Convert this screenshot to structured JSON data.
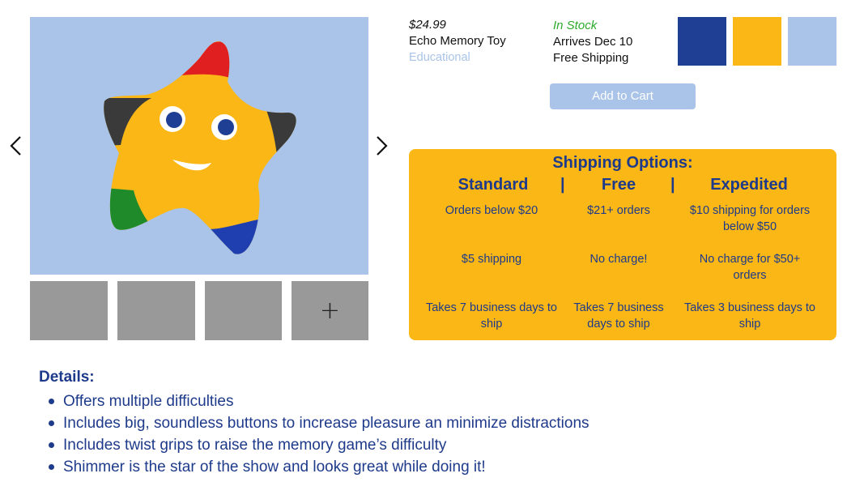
{
  "carousel": {
    "prev_icon": "chevron-left-icon",
    "next_icon": "chevron-right-icon",
    "more_thumbnails_label": "+",
    "image_colors": {
      "background": "#a9c4e8",
      "star": "#fbb716",
      "red": "#e02020",
      "dark": "#3a3a3a",
      "green": "#1f8a2a",
      "blue": "#1f3fb0"
    }
  },
  "product": {
    "price": "$24.99",
    "name": "Echo Memory Toy",
    "category": "Educational",
    "stock": "In Stock",
    "arrival": "Arrives Dec 10",
    "shipping": "Free Shipping",
    "add_to_cart": "Add to Cart",
    "swatches": [
      "#1e3f93",
      "#fbb716",
      "#a9c4e8"
    ]
  },
  "shipping_options": {
    "title": "Shipping Options:",
    "separator": "|",
    "columns": [
      {
        "name": "Standard",
        "rows": [
          "Orders below $20",
          "$5 shipping",
          "Takes 7 business days to ship"
        ]
      },
      {
        "name": "Free",
        "rows": [
          "$21+ orders",
          "No charge!",
          "Takes 7 business days to ship"
        ]
      },
      {
        "name": "Expedited",
        "rows": [
          "$10 shipping for orders below $50",
          "No charge for  $50+ orders",
          "Takes 3 business days to ship"
        ]
      }
    ]
  },
  "details": {
    "title": "Details:",
    "items": [
      "Offers multiple difficulties",
      "Includes big, soundless buttons to increase pleasure an minimize distractions",
      "Includes twist grips to raise the memory game’s difficulty",
      "Shimmer is the star of the show and looks great while doing it!"
    ]
  },
  "colors": {
    "accent": "#1e3a8a",
    "panel": "#fbb716",
    "button": "#a9c4e8",
    "in_stock": "#2daa2d"
  }
}
